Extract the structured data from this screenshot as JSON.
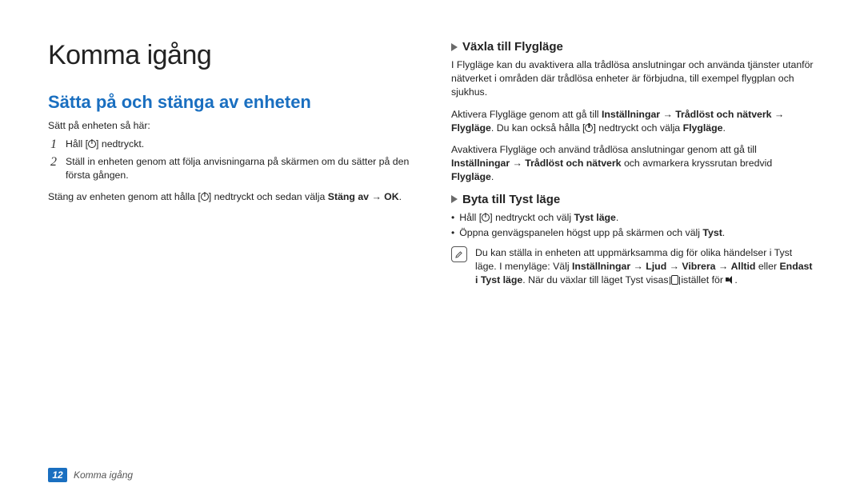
{
  "page": {
    "number": "12",
    "footer_title": "Komma igång",
    "h1": "Komma igång"
  },
  "left": {
    "h2": "Sätta på och stänga av enheten",
    "intro": "Sätt på enheten så här:",
    "step1_pre": "Håll [",
    "step1_post": "] nedtryckt.",
    "step2": "Ställ in enheten genom att följa anvisningarna på skärmen om du sätter på den första gången.",
    "off_pre": "Stäng av enheten genom att hålla [",
    "off_mid": "] nedtryckt och sedan välja ",
    "off_b1": "Stäng av",
    "off_arrow": " → ",
    "off_b2": "OK",
    "off_post": "."
  },
  "right": {
    "flight_h3": "Växla till Flygläge",
    "flight_p1": "I Flygläge kan du avaktivera alla trådlösa anslutningar och använda tjänster utanför nätverket i områden där trådlösa enheter är förbjudna, till exempel flygplan och sjukhus.",
    "flight_p2_pre": "Aktivera Flygläge genom att gå till ",
    "flight_p2_b1": "Inställningar",
    "flight_p2_arrow1": " → ",
    "flight_p2_b2": "Trådlöst och nätverk",
    "flight_p2_arrow2": " → ",
    "flight_p2_b3": "Flygläge",
    "flight_p2_mid": ". Du kan också hålla [",
    "flight_p2_post": "] nedtryckt och välja ",
    "flight_p2_b4": "Flygläge",
    "flight_p2_end": ".",
    "flight_p3_pre": "Avaktivera Flygläge och använd trådlösa anslutningar genom att gå till ",
    "flight_p3_b1": "Inställningar",
    "flight_p3_arrow": " → ",
    "flight_p3_b2": "Trådlöst och nätverk",
    "flight_p3_mid": " och avmarkera kryssrutan bredvid ",
    "flight_p3_b3": "Flygläge",
    "flight_p3_end": ".",
    "silent_h3": "Byta till Tyst läge",
    "silent_b1_pre": "Håll [",
    "silent_b1_mid": "] nedtryckt och välj ",
    "silent_b1_b": "Tyst läge",
    "silent_b1_end": ".",
    "silent_b2_pre": "Öppna genvägspanelen högst upp på skärmen och välj ",
    "silent_b2_b": "Tyst",
    "silent_b2_end": ".",
    "note_pre": "Du kan ställa in enheten att uppmärksamma dig för olika händelser i Tyst läge. I menyläge: Välj ",
    "note_b1": "Inställningar",
    "note_a1": " → ",
    "note_b2": "Ljud",
    "note_a2": " → ",
    "note_b3": "Vibrera",
    "note_a3": " → ",
    "note_b4": "Alltid",
    "note_mid": " eller ",
    "note_b5": "Endast i Tyst läge",
    "note_mid2": ". När du växlar till läget Tyst visas ",
    "note_mid3": " istället för ",
    "note_end": "."
  }
}
